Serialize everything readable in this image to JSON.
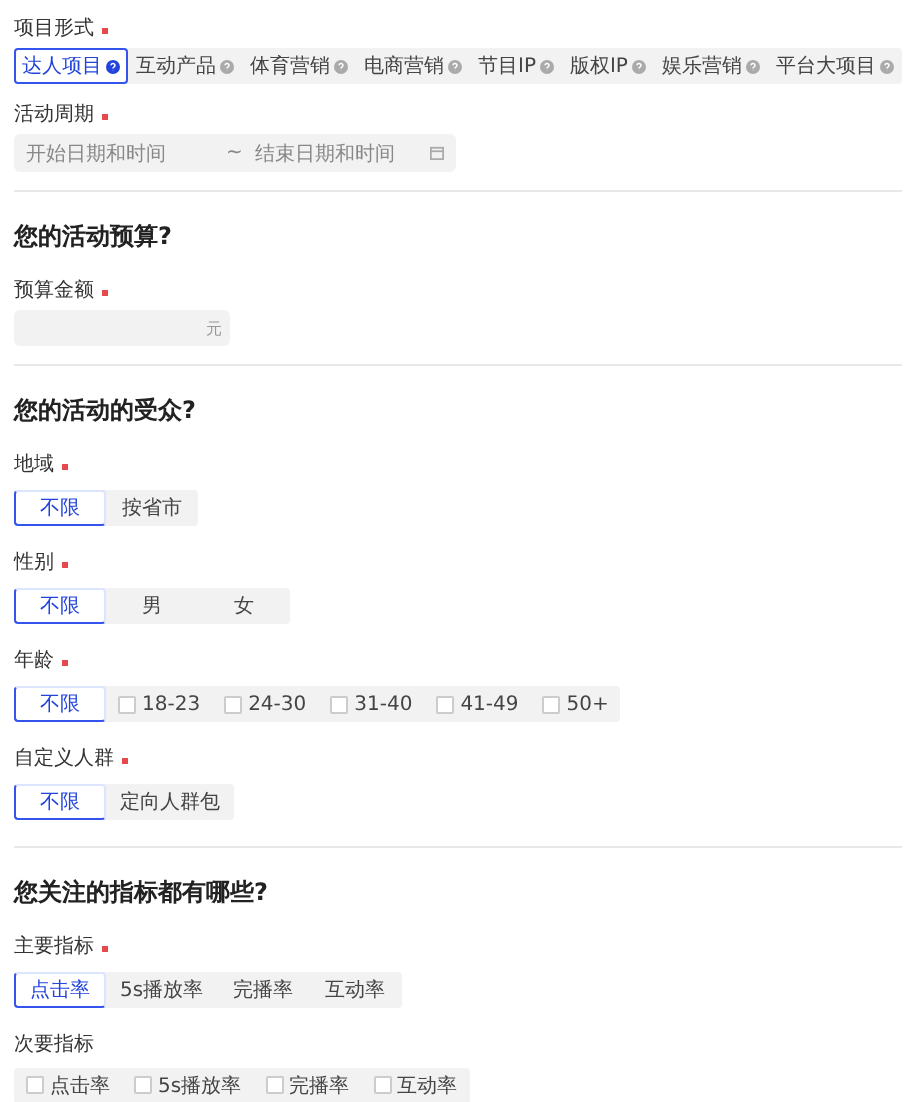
{
  "project_form": {
    "label": "项目形式",
    "required": true,
    "tabs": [
      {
        "label": "达人项目",
        "selected": true
      },
      {
        "label": "互动产品",
        "selected": false
      },
      {
        "label": "体育营销",
        "selected": false
      },
      {
        "label": "电商营销",
        "selected": false
      },
      {
        "label": "节目IP",
        "selected": false
      },
      {
        "label": "版权IP",
        "selected": false
      },
      {
        "label": "娱乐营销",
        "selected": false
      },
      {
        "label": "平台大项目",
        "selected": false
      }
    ]
  },
  "period": {
    "label": "活动周期",
    "required": true,
    "start_placeholder": "开始日期和时间",
    "separator": "~",
    "end_placeholder": "结束日期和时间"
  },
  "budget_section": {
    "title": "您的活动预算?",
    "field": {
      "label": "预算金额",
      "required": true,
      "suffix": "元"
    }
  },
  "audience_section": {
    "title": "您的活动的受众?",
    "groups": [
      {
        "label": "地域",
        "required": true,
        "options": [
          {
            "kind": "option",
            "label": "不限",
            "selected": true
          },
          {
            "kind": "option",
            "label": "按省市",
            "selected": false
          }
        ]
      },
      {
        "label": "性别",
        "required": true,
        "options": [
          {
            "kind": "option",
            "label": "不限",
            "selected": true
          },
          {
            "kind": "option",
            "label": "男",
            "selected": false
          },
          {
            "kind": "option",
            "label": "女",
            "selected": false
          }
        ]
      },
      {
        "label": "年龄",
        "required": true,
        "options": [
          {
            "kind": "option",
            "label": "不限",
            "selected": true
          },
          {
            "kind": "checkbox",
            "label": "18-23",
            "checked": false
          },
          {
            "kind": "checkbox",
            "label": "24-30",
            "checked": false
          },
          {
            "kind": "checkbox",
            "label": "31-40",
            "checked": false
          },
          {
            "kind": "checkbox",
            "label": "41-49",
            "checked": false
          },
          {
            "kind": "checkbox",
            "label": "50+",
            "checked": false
          }
        ]
      },
      {
        "label": "自定义人群",
        "required": true,
        "options": [
          {
            "kind": "option",
            "label": "不限",
            "selected": true
          },
          {
            "kind": "option",
            "label": "定向人群包",
            "selected": false
          }
        ]
      }
    ]
  },
  "metrics_section": {
    "title": "您关注的指标都有哪些?",
    "groups": [
      {
        "label": "主要指标",
        "required": true,
        "options": [
          {
            "kind": "option",
            "label": "点击率",
            "selected": true
          },
          {
            "kind": "option",
            "label": "5s播放率",
            "selected": false
          },
          {
            "kind": "option",
            "label": "完播率",
            "selected": false
          },
          {
            "kind": "option",
            "label": "互动率",
            "selected": false
          }
        ]
      },
      {
        "label": "次要指标",
        "required": false,
        "options": [
          {
            "kind": "checkbox",
            "label": "点击率",
            "checked": false
          },
          {
            "kind": "checkbox",
            "label": "5s播放率",
            "checked": false
          },
          {
            "kind": "checkbox",
            "label": "完播率",
            "checked": false
          },
          {
            "kind": "checkbox",
            "label": "互动率",
            "checked": false
          }
        ]
      }
    ]
  }
}
